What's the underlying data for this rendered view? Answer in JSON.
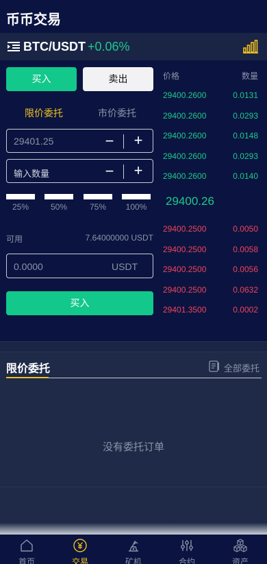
{
  "header": {
    "title": "币币交易"
  },
  "pair": {
    "symbol": "BTC/USDT",
    "change": "+0.06%"
  },
  "trade": {
    "buy_tab": "买入",
    "sell_tab": "卖出",
    "limit_tab": "限价委托",
    "market_tab": "市价委托",
    "price_value": "29401.25",
    "qty_placeholder": "输入数量",
    "minus": "−",
    "plus": "+",
    "percents": [
      "25%",
      "50%",
      "75%",
      "100%"
    ],
    "available_label": "可用",
    "available_value": "7.64000000 USDT",
    "total_value": "0.0000",
    "total_unit": "USDT",
    "submit_label": "买入"
  },
  "book": {
    "price_header": "价格",
    "qty_header": "数量",
    "bids": [
      {
        "price": "29400.2600",
        "qty": "0.0131"
      },
      {
        "price": "29400.2600",
        "qty": "0.0293"
      },
      {
        "price": "29400.2600",
        "qty": "0.0148"
      },
      {
        "price": "29400.2600",
        "qty": "0.0293"
      },
      {
        "price": "29400.2600",
        "qty": "0.0140"
      }
    ],
    "last_price": "29400.26",
    "asks": [
      {
        "price": "29400.2500",
        "qty": "0.0050"
      },
      {
        "price": "29400.2500",
        "qty": "0.0058"
      },
      {
        "price": "29400.2500",
        "qty": "0.0056"
      },
      {
        "price": "29400.2500",
        "qty": "0.0632"
      },
      {
        "price": "29401.3500",
        "qty": "0.0002"
      }
    ],
    "colors": {
      "bid": "#1ec98b",
      "ask": "#f0425a"
    }
  },
  "orders": {
    "title": "限价委托",
    "all_label": "全部委托",
    "empty_text": "没有委托订单"
  },
  "nav": {
    "items": [
      {
        "label": "首页",
        "icon": "home-icon"
      },
      {
        "label": "交易",
        "icon": "yuan-coin-icon"
      },
      {
        "label": "矿机",
        "icon": "mining-machine-icon"
      },
      {
        "label": "合约",
        "icon": "sliders-icon"
      },
      {
        "label": "资产",
        "icon": "cubes-icon"
      }
    ],
    "active": "交易"
  }
}
